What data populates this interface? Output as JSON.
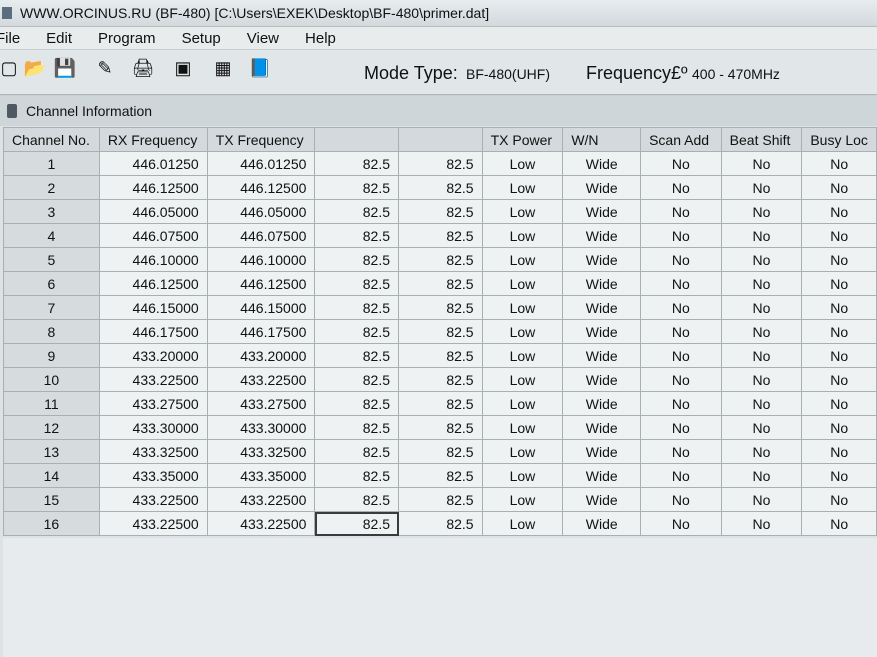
{
  "window": {
    "title": "WWW.ORCINUS.RU (BF-480) [C:\\Users\\EXEK\\Desktop\\BF-480\\primer.dat]"
  },
  "menu": [
    {
      "label": "File"
    },
    {
      "label": "Edit"
    },
    {
      "label": "Program"
    },
    {
      "label": "Setup"
    },
    {
      "label": "View"
    },
    {
      "label": "Help"
    }
  ],
  "toolbar": {
    "icons": [
      "new-icon",
      "open-icon",
      "save-icon",
      "edit-icon",
      "print-icon",
      "read-icon",
      "write-icon",
      "book-icon"
    ],
    "mode_label": "Mode Type:",
    "mode_value": "BF-480(UHF)",
    "frequency_label": "Frequency£º",
    "frequency_value": "400 - 470MHz"
  },
  "panel": {
    "title": "Channel Information"
  },
  "table": {
    "headers": [
      "Channel No.",
      "RX Frequency",
      "TX Frequency",
      "",
      "",
      "TX Power",
      "W/N",
      "Scan Add",
      "Beat Shift",
      "Busy Loc"
    ],
    "rows": [
      [
        "1",
        "446.01250",
        "446.01250",
        "82.5",
        "82.5",
        "Low",
        "Wide",
        "No",
        "No",
        "No"
      ],
      [
        "2",
        "446.12500",
        "446.12500",
        "82.5",
        "82.5",
        "Low",
        "Wide",
        "No",
        "No",
        "No"
      ],
      [
        "3",
        "446.05000",
        "446.05000",
        "82.5",
        "82.5",
        "Low",
        "Wide",
        "No",
        "No",
        "No"
      ],
      [
        "4",
        "446.07500",
        "446.07500",
        "82.5",
        "82.5",
        "Low",
        "Wide",
        "No",
        "No",
        "No"
      ],
      [
        "5",
        "446.10000",
        "446.10000",
        "82.5",
        "82.5",
        "Low",
        "Wide",
        "No",
        "No",
        "No"
      ],
      [
        "6",
        "446.12500",
        "446.12500",
        "82.5",
        "82.5",
        "Low",
        "Wide",
        "No",
        "No",
        "No"
      ],
      [
        "7",
        "446.15000",
        "446.15000",
        "82.5",
        "82.5",
        "Low",
        "Wide",
        "No",
        "No",
        "No"
      ],
      [
        "8",
        "446.17500",
        "446.17500",
        "82.5",
        "82.5",
        "Low",
        "Wide",
        "No",
        "No",
        "No"
      ],
      [
        "9",
        "433.20000",
        "433.20000",
        "82.5",
        "82.5",
        "Low",
        "Wide",
        "No",
        "No",
        "No"
      ],
      [
        "10",
        "433.22500",
        "433.22500",
        "82.5",
        "82.5",
        "Low",
        "Wide",
        "No",
        "No",
        "No"
      ],
      [
        "11",
        "433.27500",
        "433.27500",
        "82.5",
        "82.5",
        "Low",
        "Wide",
        "No",
        "No",
        "No"
      ],
      [
        "12",
        "433.30000",
        "433.30000",
        "82.5",
        "82.5",
        "Low",
        "Wide",
        "No",
        "No",
        "No"
      ],
      [
        "13",
        "433.32500",
        "433.32500",
        "82.5",
        "82.5",
        "Low",
        "Wide",
        "No",
        "No",
        "No"
      ],
      [
        "14",
        "433.35000",
        "433.35000",
        "82.5",
        "82.5",
        "Low",
        "Wide",
        "No",
        "No",
        "No"
      ],
      [
        "15",
        "433.22500",
        "433.22500",
        "82.5",
        "82.5",
        "Low",
        "Wide",
        "No",
        "No",
        "No"
      ],
      [
        "16",
        "433.22500",
        "433.22500",
        "82.5",
        "82.5",
        "Low",
        "Wide",
        "No",
        "No",
        "No"
      ]
    ]
  }
}
